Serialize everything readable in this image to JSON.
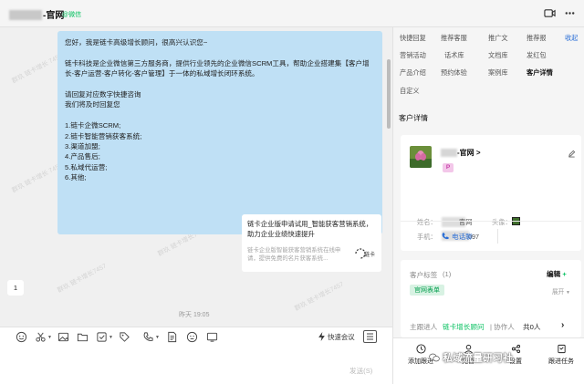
{
  "header": {
    "title": "-官网",
    "source": "@微信",
    "icons": [
      "video-call-icon",
      "more-icon"
    ]
  },
  "chat": {
    "watermark_texts": [
      "群玖 链卡增长 7457",
      "群玖 链卡增长7457"
    ],
    "main_message_lines": [
      "您好，我是链卡高级增长顾问，很高兴认识您~",
      "",
      "链卡科技是企业微信第三方服务商，提供行业领先的企业微信SCRM工具，帮助企业搭建集【客户增",
      "长-客户运营-客户转化-客户管理】于一体的私域增长闭环系统。",
      "",
      "请回复对应数字快捷咨询",
      "我们将及时回复您",
      "",
      "1.链卡企微SCRM;",
      "2.链卡智能营销获客系统;",
      "3.渠道加盟;",
      "4.产品售后;",
      "5.私域代运营;",
      "6.其他;"
    ],
    "card": {
      "title": "链卡企业版申请试用_智能获客营销系统，助力企业业绩快速提升",
      "description": "链卡企业版智能获客营销系统在线申请，提供免费的名片获客系统...",
      "logo_text": "链卡"
    },
    "reply": "1",
    "timestamp": "昨天 19:05"
  },
  "input": {
    "tool_icons": [
      "emoji-icon",
      "scissors-icon",
      "image-icon",
      "folder-icon",
      "checklist-icon",
      "tag-icon",
      "phone-icon",
      "doc-icon",
      "face-icon",
      "screen-icon"
    ],
    "quick_meeting": "快速会议",
    "send_label": "发送(S)"
  },
  "right_panel": {
    "tabs": [
      [
        "快捷回复",
        "推荐客服",
        "推广文",
        "推荐报"
      ],
      [
        "营销活动",
        "话术库",
        "文档库",
        "发红包"
      ],
      [
        "产品介绍",
        "预约体验",
        "案例库",
        "客户详情"
      ],
      [
        "自定义"
      ]
    ],
    "active_tab": "客户详情",
    "collapse_label": "收起",
    "section_title": "客户详情",
    "customer": {
      "name": "-官网",
      "name_suffix": ">",
      "badge": "P",
      "name_label": "姓名：",
      "name_value": "官网",
      "avatar_label": "头像：",
      "phone_label": "手机：",
      "phone_value": "097",
      "call_label": "电话聊"
    },
    "customer_tags": {
      "label": "客户标签",
      "count": "(1)",
      "edit": "编辑",
      "tag": "官网表单",
      "expand": "展开"
    },
    "owner": {
      "label": "主跟进人",
      "value": "链卡增长顾问",
      "collab_label": "协作人",
      "collab_value": "共0人"
    },
    "bottom_actions": [
      "添加跟进",
      "完善",
      "设置",
      "跟进任务"
    ],
    "overlay_watermark": "私域流量研习社"
  }
}
